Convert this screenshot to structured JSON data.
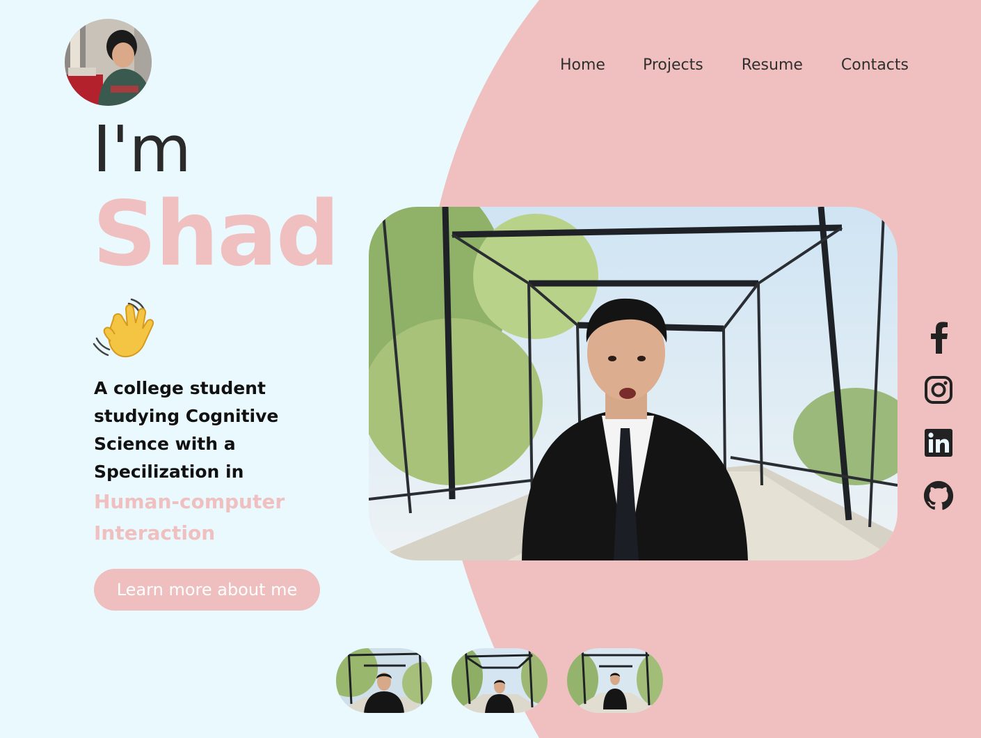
{
  "colors": {
    "background": "#e9f9fe",
    "accent_pink": "#efbfbf",
    "text_dark": "#2b2b2b"
  },
  "header": {
    "avatar_icon": "profile-photo",
    "nav": [
      {
        "label": "Home"
      },
      {
        "label": "Projects"
      },
      {
        "label": "Resume"
      },
      {
        "label": "Contacts"
      }
    ]
  },
  "intro": {
    "greeting": "I'm",
    "name": "Shad",
    "wave_icon": "waving-hand-emoji",
    "tagline": "A college student studying Cognitive Science with a Specilization in",
    "highlight": "Human-computer Interaction",
    "cta_label": "Learn more about me"
  },
  "hero": {
    "image_icon": "photo-man-in-suit-on-bridge"
  },
  "social": [
    {
      "icon": "facebook-icon"
    },
    {
      "icon": "instagram-icon"
    },
    {
      "icon": "linkedin-icon"
    },
    {
      "icon": "github-icon"
    }
  ],
  "gallery": {
    "thumbnails": [
      "thumb-1",
      "thumb-2",
      "thumb-3"
    ]
  }
}
